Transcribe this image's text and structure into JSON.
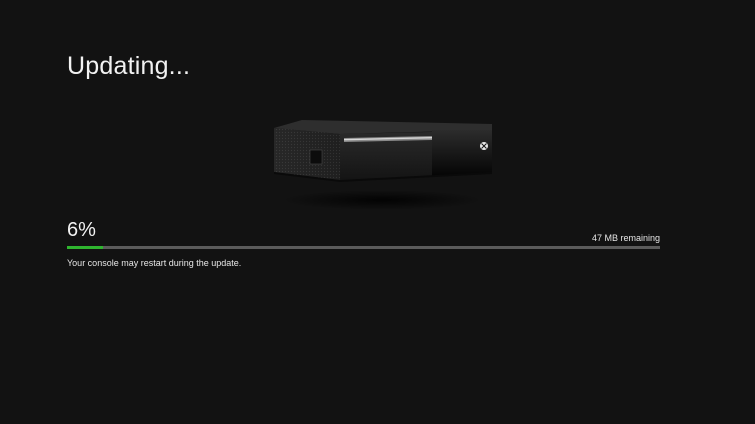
{
  "screen": {
    "title": "Updating...",
    "background_color": "#121212"
  },
  "console_image": {
    "icon": "xbox-console-image"
  },
  "progress": {
    "percent_label": "6%",
    "value": 0.06,
    "remaining_label": "47 MB remaining",
    "note": "Your console may restart during the update.",
    "fill_color": "#2fb52f",
    "track_color": "#5b5b5b"
  }
}
